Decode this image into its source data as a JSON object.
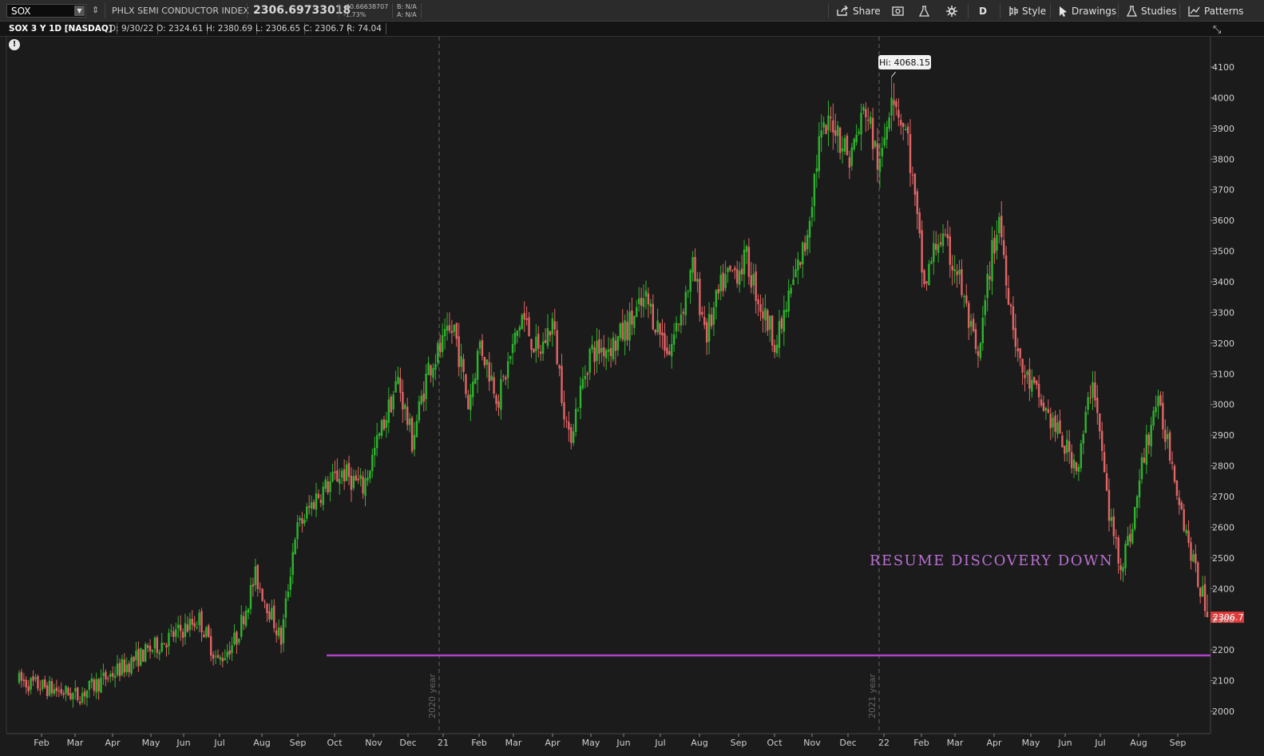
{
  "toolbar": {
    "symbol": "SOX",
    "index_name": "PHLX SEMI CONDUCTOR INDEX",
    "last": "2306.69733018",
    "net_change": "-40.66638707",
    "pct_change": "-1.73%",
    "bid": "B: N/A",
    "ask": "A: N/A",
    "share": "Share",
    "aggregation": "D",
    "style": "Style",
    "drawings": "Drawings",
    "studies": "Studies",
    "patterns": "Patterns"
  },
  "info": {
    "symbol_desc": "SOX 3 Y 1D [NASDAQ]",
    "date": "D: 9/30/22",
    "open": "O: 2324.61",
    "high": "H: 2380.69",
    "low": "L: 2306.65",
    "close": "C: 2306.7",
    "range": "R: 74.04"
  },
  "chart_data": {
    "type": "candlestick",
    "y_ticks": [
      2000,
      2100,
      2200,
      2300,
      2400,
      2500,
      2600,
      2700,
      2800,
      2900,
      3000,
      3100,
      3200,
      3300,
      3400,
      3500,
      3600,
      3700,
      3800,
      3900,
      4000,
      4100
    ],
    "x_ticks": [
      "Feb",
      "Mar",
      "Apr",
      "May",
      "Jun",
      "Jul",
      "Aug",
      "Sep",
      "Oct",
      "Nov",
      "Dec",
      "21",
      "Feb",
      "Mar",
      "Apr",
      "May",
      "Jun",
      "Jul",
      "Aug",
      "Sep",
      "Oct",
      "Nov",
      "Dec",
      "22",
      "Feb",
      "Mar",
      "Apr",
      "May",
      "Jun",
      "Jul",
      "Aug",
      "Sep"
    ],
    "hi_label": "Hi: 4068.15",
    "last_label": "2306.7",
    "year_markers": [
      "2020 year",
      "2021 year"
    ],
    "annotation": "RESUME DISCOVERY DOWN",
    "support_level": 2182,
    "hi_value": 4068.15,
    "last_value": 2306.7,
    "colors": {
      "up": "#2db52d",
      "down": "#e26565",
      "support": "#b043c8",
      "annotation": "#b86fd0"
    },
    "trend_anchors": [
      [
        1575,
        2100
      ],
      [
        1600,
        2050
      ],
      [
        1635,
        2220
      ],
      [
        1652,
        2300
      ],
      [
        1660,
        2160
      ],
      [
        1668,
        2240
      ],
      [
        1676,
        2440
      ],
      [
        1681,
        2350
      ],
      [
        1687,
        2230
      ],
      [
        1693,
        2580
      ],
      [
        1702,
        2700
      ],
      [
        1713,
        2780
      ],
      [
        1722,
        2730
      ],
      [
        1730,
        2920
      ],
      [
        1737,
        3080
      ],
      [
        1743,
        2880
      ],
      [
        1750,
        3120
      ],
      [
        1761,
        3250
      ],
      [
        1767,
        3000
      ],
      [
        1772,
        3200
      ],
      [
        1780,
        3020
      ],
      [
        1790,
        3290
      ],
      [
        1797,
        3160
      ],
      [
        1803,
        3270
      ],
      [
        1810,
        2880
      ],
      [
        1819,
        3170
      ],
      [
        1830,
        3200
      ],
      [
        1843,
        3340
      ],
      [
        1853,
        3170
      ],
      [
        1863,
        3440
      ],
      [
        1869,
        3230
      ],
      [
        1876,
        3400
      ],
      [
        1886,
        3470
      ],
      [
        1893,
        3300
      ],
      [
        1899,
        3200
      ],
      [
        1906,
        3400
      ],
      [
        1911,
        3520
      ],
      [
        1917,
        3850
      ],
      [
        1923,
        3930
      ],
      [
        1930,
        3800
      ],
      [
        1937,
        3970
      ],
      [
        1943,
        3760
      ],
      [
        1948,
        4040
      ],
      [
        1955,
        3860
      ],
      [
        1962,
        3380
      ],
      [
        1968,
        3550
      ],
      [
        1976,
        3440
      ],
      [
        1985,
        3130
      ],
      [
        1990,
        3450
      ],
      [
        1994,
        3610
      ],
      [
        1998,
        3370
      ],
      [
        2003,
        3120
      ],
      [
        2010,
        3030
      ],
      [
        2016,
        2950
      ],
      [
        2022,
        2860
      ],
      [
        2028,
        2800
      ],
      [
        2034,
        3100
      ],
      [
        2041,
        2640
      ],
      [
        2046,
        2480
      ],
      [
        2051,
        2600
      ],
      [
        2055,
        2800
      ],
      [
        2061,
        3010
      ],
      [
        2066,
        2890
      ],
      [
        2071,
        2700
      ],
      [
        2073,
        2620
      ],
      [
        2078,
        2450
      ],
      [
        2083,
        2330
      ]
    ]
  }
}
